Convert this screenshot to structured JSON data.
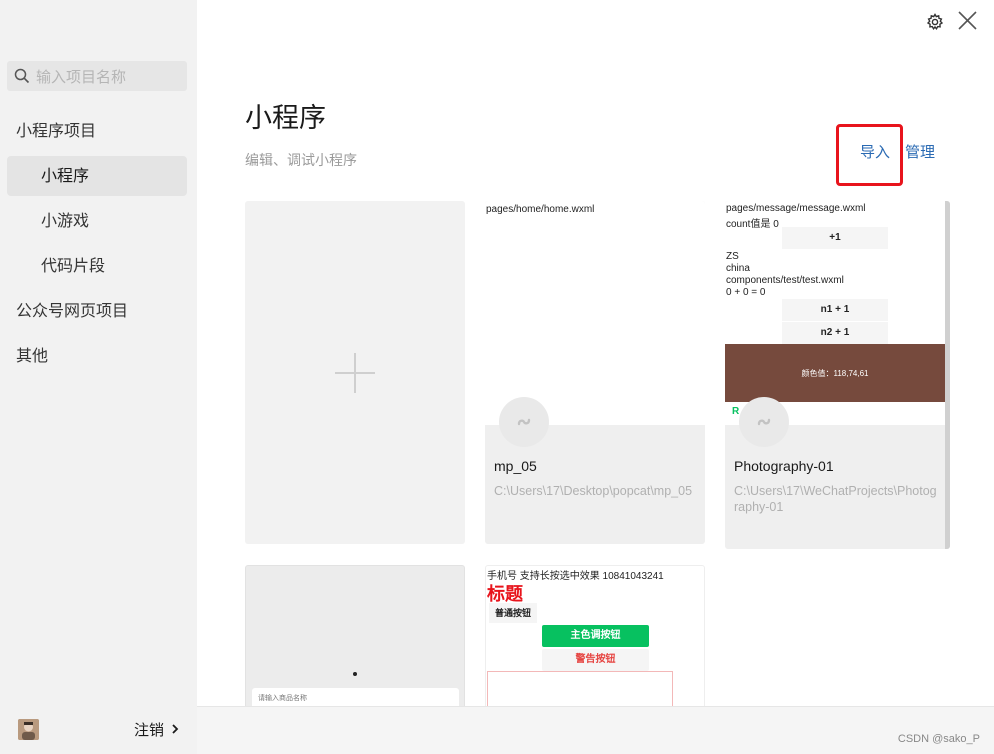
{
  "sidebar": {
    "search_placeholder": "输入项目名称",
    "items": [
      {
        "label": "小程序项目"
      },
      {
        "label": "小程序"
      },
      {
        "label": "小游戏"
      },
      {
        "label": "代码片段"
      },
      {
        "label": "公众号网页项目"
      },
      {
        "label": "其他"
      }
    ],
    "logout_label": "注销"
  },
  "header": {
    "title": "小程序",
    "subtitle": "编辑、调试小程序",
    "import_label": "导入",
    "manage_label": "管理"
  },
  "projects": [
    {
      "name": "mp_05",
      "path": "C:\\Users\\17\\Desktop\\popcat\\mp_05",
      "preview": {
        "line1": "pages/home/home.wxml"
      }
    },
    {
      "name": "Photography-01",
      "path": "C:\\Users\\17\\WeChatProjects\\Photography-01",
      "preview": {
        "line1": "pages/message/message.wxml",
        "line2": "count值是 0",
        "btn1": "+1",
        "line3": "ZS",
        "line4": "china",
        "line5": "components/test/test.wxml",
        "line6": "0 + 0 = 0",
        "btn2": "n1 + 1",
        "btn3": "n2 + 1",
        "color_text": "颜色值：118,74,61",
        "letter": "R",
        "color_block": "#764a3d"
      }
    },
    {
      "preview": {
        "input_placeholder": "请输入商品名称"
      }
    },
    {
      "preview": {
        "line1": "手机号 支持长按选中效果 10841043241",
        "heading": "标题",
        "btn1": "普通按钮",
        "btn2": "主色调按钮",
        "btn3": "警告按钮"
      }
    }
  ],
  "watermark": "CSDN @sako_P",
  "colors": {
    "sidebar_bg": "#f2f2f2",
    "link": "#2a6ab3",
    "highlight_box": "#e8141c",
    "primary_green": "#07c160",
    "warn_red": "#e64340"
  },
  "icons": [
    "search-icon",
    "settings-icon",
    "close-icon",
    "plus-icon",
    "miniprogram-logo-icon",
    "chevron-right-icon"
  ]
}
